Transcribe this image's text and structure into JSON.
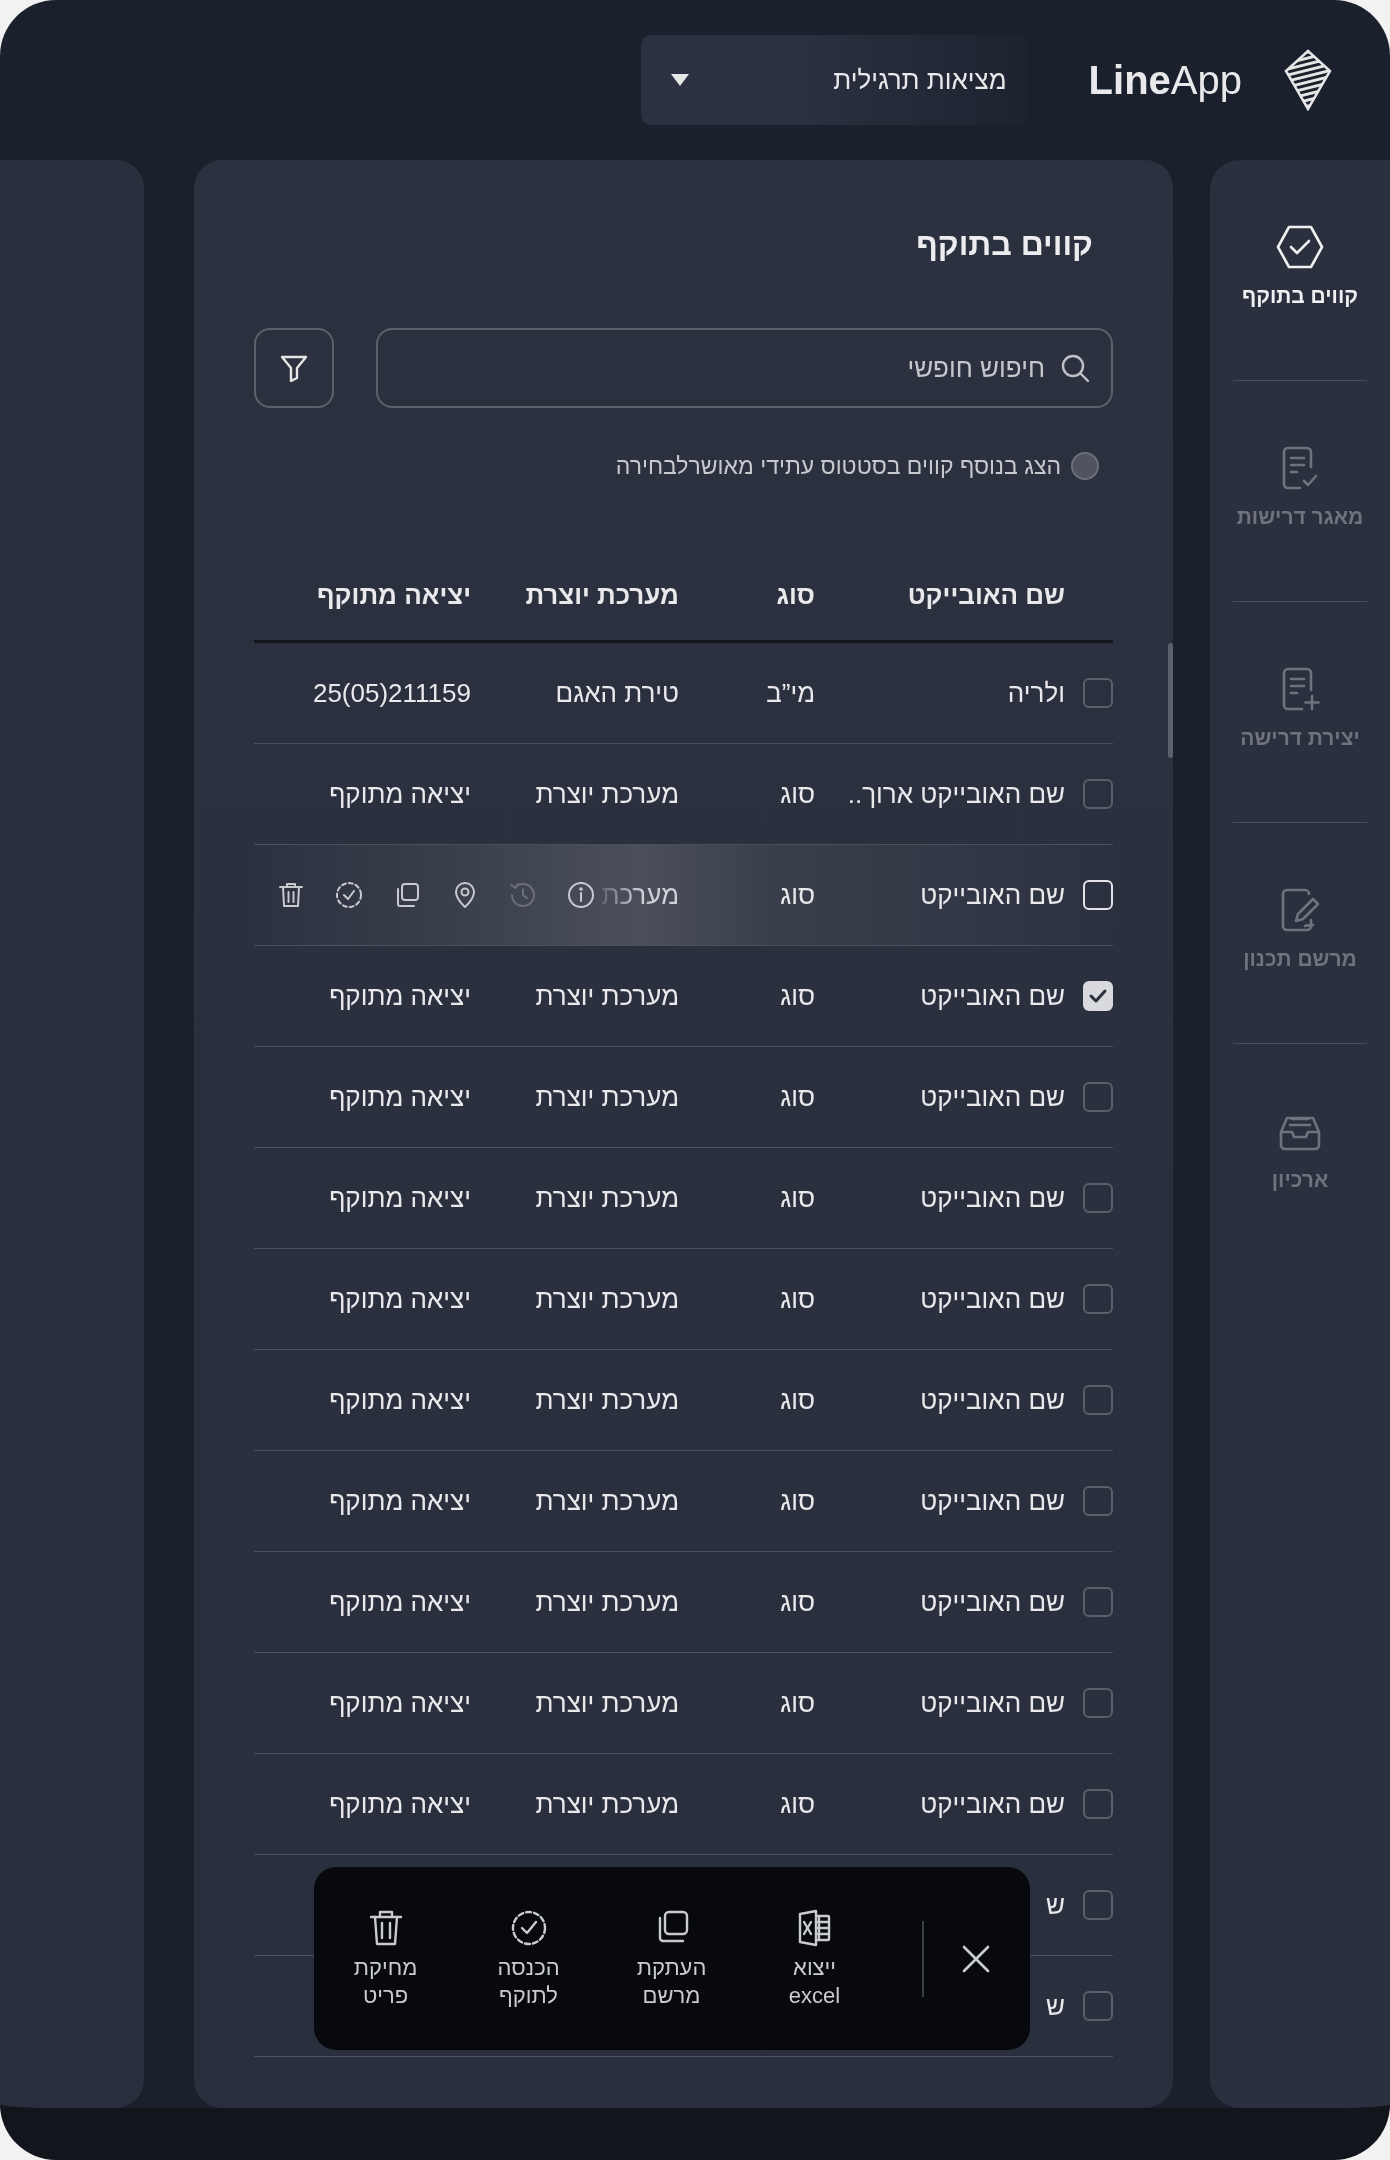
{
  "header": {
    "brand": "**Line**App",
    "project": {
      "value": "מציאות תרגילית"
    }
  },
  "sidebar": {
    "items": [
      {
        "label": "קווים בתוקף",
        "selected": true
      },
      {
        "label": "מאגר דרישות",
        "selected": false
      },
      {
        "label": "יצירת דרישה",
        "selected": false
      },
      {
        "label": "מרשם תכנון",
        "selected": false
      },
      {
        "label": "ארכיון",
        "selected": false
      }
    ]
  },
  "main": {
    "title": "קווים בתוקף",
    "search": {
      "placeholder": "חיפוש חופשי"
    },
    "future_toggle": {
      "label": "הצג בנוסף קווים בסטטוס עתידי מאושרלבחירה",
      "on": false
    }
  },
  "table": {
    "columns": [
      "שם האובייקט",
      "סוג",
      "מערכת יוצרת",
      "יציאה מתוקף"
    ],
    "row_actions": [
      {
        "disabled": false
      },
      {
        "disabled": true
      },
      {
        "disabled": false
      },
      {
        "disabled": false
      },
      {
        "disabled": false
      },
      {
        "disabled": false
      }
    ],
    "rows": [
      {
        "checked": false,
        "hovered": false,
        "cells": [
          "ולריה",
          "מי”ב",
          "טירת האגם",
          "25(05)211159"
        ]
      },
      {
        "checked": false,
        "hovered": false,
        "cells": [
          "שם האובייקט ארוך..",
          "סוג",
          "מערכת יוצרת",
          "יציאה מתוקף"
        ]
      },
      {
        "checked": false,
        "hovered": true,
        "cells": [
          "שם האובייקט",
          "סוג",
          "מערכת"
        ]
      },
      {
        "checked": true,
        "hovered": false,
        "cells": [
          "שם האובייקט",
          "סוג",
          "מערכת יוצרת",
          "יציאה מתוקף"
        ]
      },
      {
        "checked": false,
        "hovered": false,
        "cells": [
          "שם האובייקט",
          "סוג",
          "מערכת יוצרת",
          "יציאה מתוקף"
        ]
      },
      {
        "checked": false,
        "hovered": false,
        "cells": [
          "שם האובייקט",
          "סוג",
          "מערכת יוצרת",
          "יציאה מתוקף"
        ]
      },
      {
        "checked": false,
        "hovered": false,
        "cells": [
          "שם האובייקט",
          "סוג",
          "מערכת יוצרת",
          "יציאה מתוקף"
        ]
      },
      {
        "checked": false,
        "hovered": false,
        "cells": [
          "שם האובייקט",
          "סוג",
          "מערכת יוצרת",
          "יציאה מתוקף"
        ]
      },
      {
        "checked": false,
        "hovered": false,
        "cells": [
          "שם האובייקט",
          "סוג",
          "מערכת יוצרת",
          "יציאה מתוקף"
        ]
      },
      {
        "checked": false,
        "hovered": false,
        "cells": [
          "שם האובייקט",
          "סוג",
          "מערכת יוצרת",
          "יציאה מתוקף"
        ]
      },
      {
        "checked": false,
        "hovered": false,
        "cells": [
          "שם האובייקט",
          "סוג",
          "מערכת יוצרת",
          "יציאה מתוקף"
        ]
      },
      {
        "checked": false,
        "hovered": false,
        "cells": [
          "שם האובייקט",
          "סוג",
          "מערכת יוצרת",
          "יציאה מתוקף"
        ]
      },
      {
        "checked": false,
        "hovered": false,
        "cells": [
          "ש"
        ]
      },
      {
        "checked": false,
        "hovered": false,
        "cells": [
          "ש"
        ]
      }
    ]
  },
  "selection_bar": {
    "actions": [
      {
        "label": "ייצוא\nexcel"
      },
      {
        "label": "העתקת\nמרשם"
      },
      {
        "label": "הכנסה\nלתוקף"
      },
      {
        "label": "מחיקת\nפריט"
      }
    ]
  }
}
